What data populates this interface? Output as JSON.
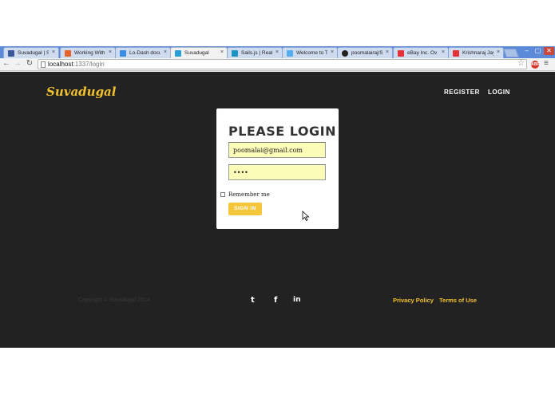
{
  "browser": {
    "tabs": [
      {
        "title": "Suvadugal | S",
        "favicon_color": "#3b5998",
        "active": false
      },
      {
        "title": "Working With",
        "favicon_color": "#e8612c",
        "active": false
      },
      {
        "title": "Lo-Dash docu",
        "favicon_color": "#3a8ee6",
        "active": false
      },
      {
        "title": "Suvadugal",
        "favicon_color": "#2a9fd6",
        "active": true
      },
      {
        "title": "Sails.js | Real",
        "favicon_color": "#1b93c4",
        "active": false
      },
      {
        "title": "Welcome to T",
        "favicon_color": "#55acee",
        "active": false
      },
      {
        "title": "poomalairaj/S",
        "favicon_color": "#222222",
        "active": false
      },
      {
        "title": "eBay Inc. Ov",
        "favicon_color": "#e53238",
        "active": false
      },
      {
        "title": "Krishnaraj Jay",
        "favicon_color": "#e53238",
        "active": false
      }
    ],
    "close_glyph": "×",
    "url_host": "localhost",
    "url_path": ":1337/login",
    "back_icon": "back-arrow-icon",
    "forward_icon": "forward-arrow-icon",
    "reload_icon": "reload-icon",
    "star_icon": "bookmark-star-icon",
    "adblock_label": "ABP",
    "menu_icon": "hamburger-menu-icon",
    "window_controls": [
      "–",
      "▢",
      "✕"
    ]
  },
  "site": {
    "brand": "Suvadugal",
    "nav": {
      "register": "REGISTER",
      "login": "LOGIN"
    },
    "accent_color": "#f2c12e",
    "background_color": "#222222"
  },
  "login": {
    "title": "PLEASE LOGIN",
    "email_value": "poomalai@gmail.com",
    "password_mask": "••••",
    "remember_label": "Remember me",
    "signin_label": "SIGN IN"
  },
  "footer": {
    "copyright": "Copyright © Suvadugal 2014",
    "social": {
      "twitter": "t",
      "facebook": "f",
      "linkedin": "in"
    },
    "links": {
      "privacy": "Privacy Policy",
      "terms": "Terms of Use"
    }
  }
}
